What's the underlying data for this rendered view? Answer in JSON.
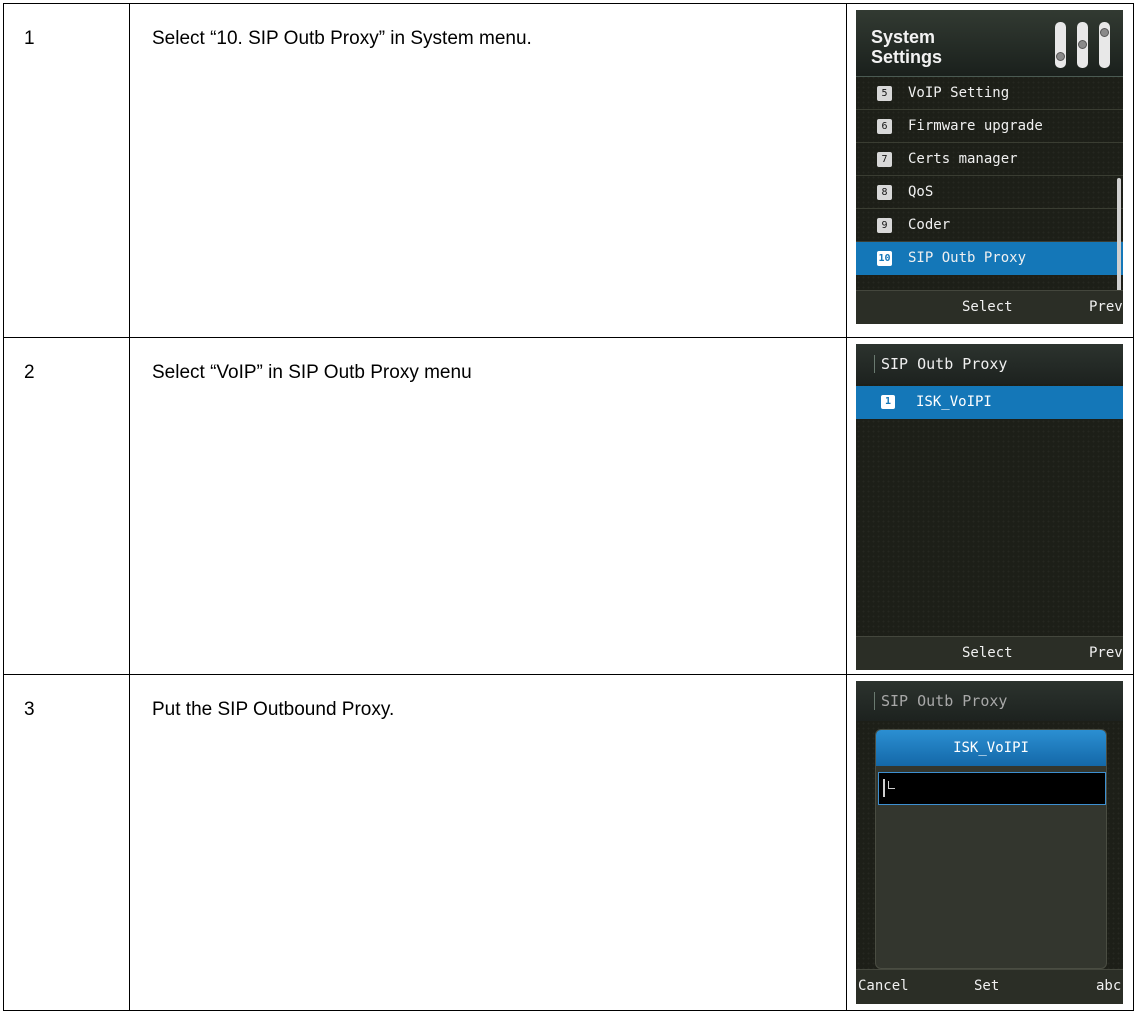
{
  "rows": [
    {
      "step": "1",
      "description": "Select “10. SIP Outb Proxy” in System menu.",
      "screen": {
        "header_title_line1": "System",
        "header_title_line2": "Settings",
        "menu_items": [
          {
            "num": "5",
            "label": "VoIP Setting"
          },
          {
            "num": "6",
            "label": "Firmware upgrade"
          },
          {
            "num": "7",
            "label": "Certs manager"
          },
          {
            "num": "8",
            "label": "QoS"
          },
          {
            "num": "9",
            "label": "Coder"
          },
          {
            "num": "10",
            "label": "SIP Outb Proxy",
            "selected": true
          }
        ],
        "softkeys": {
          "center": "Select",
          "right": "Prev"
        }
      }
    },
    {
      "step": "2",
      "description": "Select “VoIP” in SIP Outb Proxy menu",
      "screen": {
        "header_title": "SIP Outb Proxy",
        "items": [
          {
            "num": "1",
            "label": "ISK_VoIPI",
            "selected": true
          }
        ],
        "softkeys": {
          "center": "Select",
          "right": "Prev"
        }
      }
    },
    {
      "step": "3",
      "description": "Put the SIP Outbound Proxy.",
      "screen": {
        "header_title": "SIP Outb Proxy",
        "dialog_title": "ISK_VoIPI",
        "input_value": "",
        "softkeys": {
          "left": "Cancel",
          "center": "Set",
          "right": "abc"
        }
      }
    }
  ],
  "colors": {
    "highlight": "#1477b8",
    "screen_background": "#1d1f18",
    "softkey_bar": "#2b2e26"
  },
  "icons": {
    "settings_header": "sliders-icon",
    "text_cursor": "text-cursor-icon"
  }
}
